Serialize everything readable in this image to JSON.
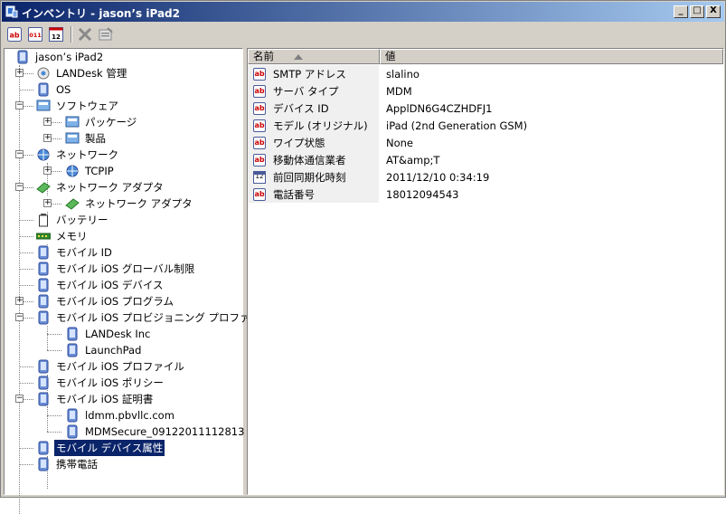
{
  "window": {
    "title": "インベントリ - jason’s iPad2",
    "minimize": "_",
    "maximize": "□",
    "close": "X"
  },
  "toolbar": {
    "buttons": [
      {
        "name": "text-attribute-button",
        "icon": "ab-icon",
        "glyph": "ab"
      },
      {
        "name": "binary-attribute-button",
        "icon": "binary-icon",
        "glyph": "011"
      },
      {
        "name": "date-attribute-button",
        "icon": "calendar-icon",
        "glyph": "12"
      },
      {
        "name": "delete-button",
        "icon": "delete-x-icon",
        "glyph": ""
      },
      {
        "name": "properties-button",
        "icon": "properties-icon",
        "glyph": ""
      }
    ]
  },
  "tree": {
    "root": "jason’s iPad2",
    "items": [
      "LANDesk 管理",
      "OS",
      "ソフトウェア",
      "パッケージ",
      "製品",
      "ネットワーク",
      "TCPIP",
      "ネットワーク アダプタ",
      "ネットワーク アダプタ",
      "バッテリー",
      "メモリ",
      "モバイル ID",
      "モバイル iOS グローバル制限",
      "モバイル iOS デバイス",
      "モバイル iOS プログラム",
      "モバイル iOS プロビジョニング プロファイル",
      "LANDesk Inc",
      "LaunchPad",
      "モバイル iOS プロファイル",
      "モバイル iOS ポリシー",
      "モバイル iOS 証明書",
      "ldmm.pbvllc.com",
      "MDMSecure_09122011112813",
      "モバイル デバイス属性",
      "携帯電話"
    ]
  },
  "list": {
    "col_name": "名前",
    "col_value": "値",
    "rows": [
      {
        "name": "SMTP アドレス",
        "value": "slalino",
        "icon": "ab-icon"
      },
      {
        "name": "サーバ タイプ",
        "value": "MDM",
        "icon": "ab-icon"
      },
      {
        "name": "デバイス ID",
        "value": "ApplDN6G4CZHDFJ1",
        "icon": "ab-icon"
      },
      {
        "name": "モデル (オリジナル)",
        "value": "iPad (2nd Generation GSM)",
        "icon": "ab-icon"
      },
      {
        "name": "ワイプ状態",
        "value": "None",
        "icon": "ab-icon"
      },
      {
        "name": "移動体通信業者",
        "value": "AT&amp;T",
        "icon": "ab-icon"
      },
      {
        "name": "前回同期化時刻",
        "value": "2011/12/10 0:34:19",
        "icon": "calendar-icon"
      },
      {
        "name": "電話番号",
        "value": "18012094543",
        "icon": "ab-icon"
      }
    ]
  },
  "colors": {
    "titlebar_start": "#0a246a",
    "titlebar_end": "#a6caf0",
    "selection": "#0a246a",
    "chrome": "#d4d0c8"
  }
}
